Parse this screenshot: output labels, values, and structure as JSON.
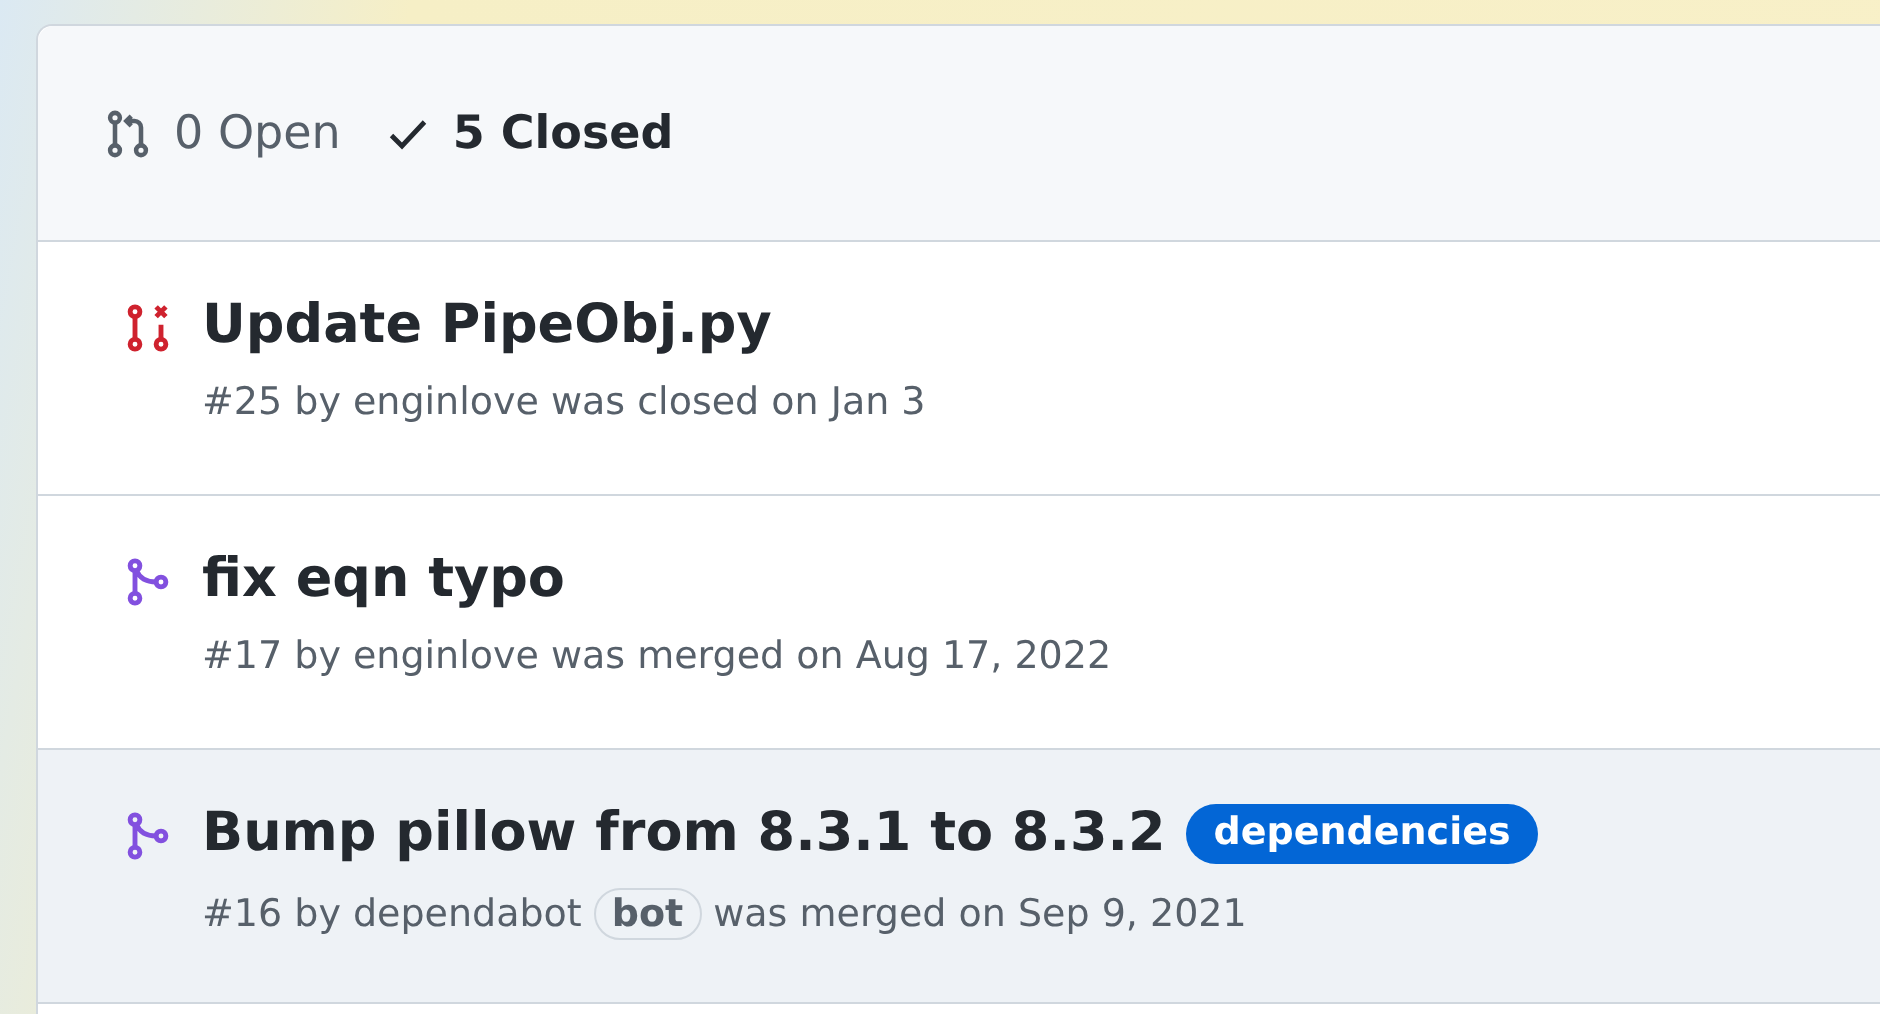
{
  "tabs": [
    {
      "kind": "open",
      "label": "0 Open",
      "selected": false
    },
    {
      "kind": "closed",
      "label": "5 Closed",
      "selected": true
    }
  ],
  "pull_requests": [
    {
      "kind": "closed",
      "title": "Update PipeObj.py",
      "meta": "#25 by enginlove was closed on Jan 3",
      "highlighted": false
    },
    {
      "kind": "merged",
      "title": "fix eqn typo",
      "meta": "#17 by enginlove was merged on Aug 17, 2022",
      "highlighted": false
    },
    {
      "kind": "merged",
      "title": "Bump pillow from 8.3.1 to 8.3.2",
      "labels": [
        {
          "text": "dependencies",
          "color": "#0366d6"
        }
      ],
      "meta": "#16 by dependabot",
      "badge": "bot",
      "meta_after": "was merged on Sep 9, 2021",
      "highlighted": true
    }
  ]
}
